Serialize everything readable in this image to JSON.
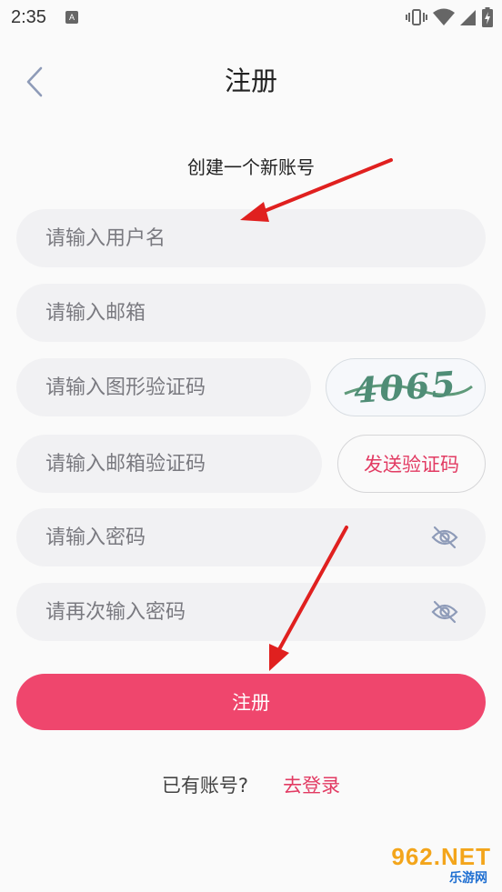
{
  "status_bar": {
    "time": "2:35",
    "notification_badge": "A"
  },
  "header": {
    "title": "注册"
  },
  "subtitle": "创建一个新账号",
  "form": {
    "username_placeholder": "请输入用户名",
    "email_placeholder": "请输入邮箱",
    "captcha_placeholder": "请输入图形验证码",
    "captcha_text": "4065",
    "email_code_placeholder": "请输入邮箱验证码",
    "send_code_label": "发送验证码",
    "password_placeholder": "请输入密码",
    "confirm_password_placeholder": "请再次输入密码",
    "submit_label": "注册"
  },
  "footer": {
    "have_account": "已有账号?",
    "login_link": "去登录"
  },
  "watermark": {
    "main": "962.NET",
    "sub": "乐游网"
  },
  "colors": {
    "accent": "#ef466d",
    "link": "#e23b63",
    "field_bg": "#f1f1f3",
    "arrow": "#e0201f"
  },
  "icons": {
    "back": "chevron-left-icon",
    "password_toggle": "eye-off-icon"
  }
}
